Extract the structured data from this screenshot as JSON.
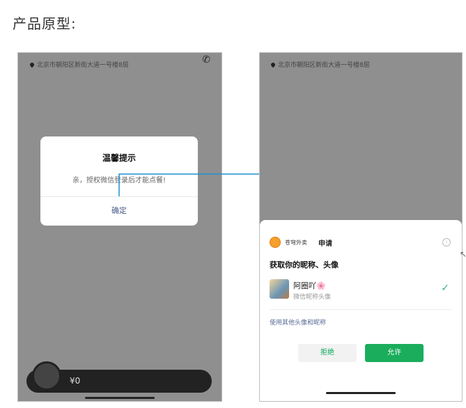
{
  "heading": "产品原型:",
  "left_phone": {
    "address": "北京市朝阳区新街大道一号楼8层",
    "dialog": {
      "title": "温馨提示",
      "message": "亲，授权微信登录后才能点餐!",
      "confirm": "确定"
    },
    "cart": {
      "price": "¥0"
    }
  },
  "right_phone": {
    "address": "北京市朝阳区新街大道一号楼8层",
    "sheet": {
      "app_name": "苍穹外卖",
      "apply": "申请",
      "title": "获取你的昵称、头像",
      "nickname": "阿圈吖🌸",
      "nickname_sub": "微信昵称头像",
      "use_other": "使用其他头像和昵称",
      "reject": "拒绝",
      "allow": "允许"
    }
  },
  "colors": {
    "accent_green": "#1aad5c",
    "arrow_blue": "#1e90d6",
    "overlay_gray": "#8f8f8f"
  }
}
